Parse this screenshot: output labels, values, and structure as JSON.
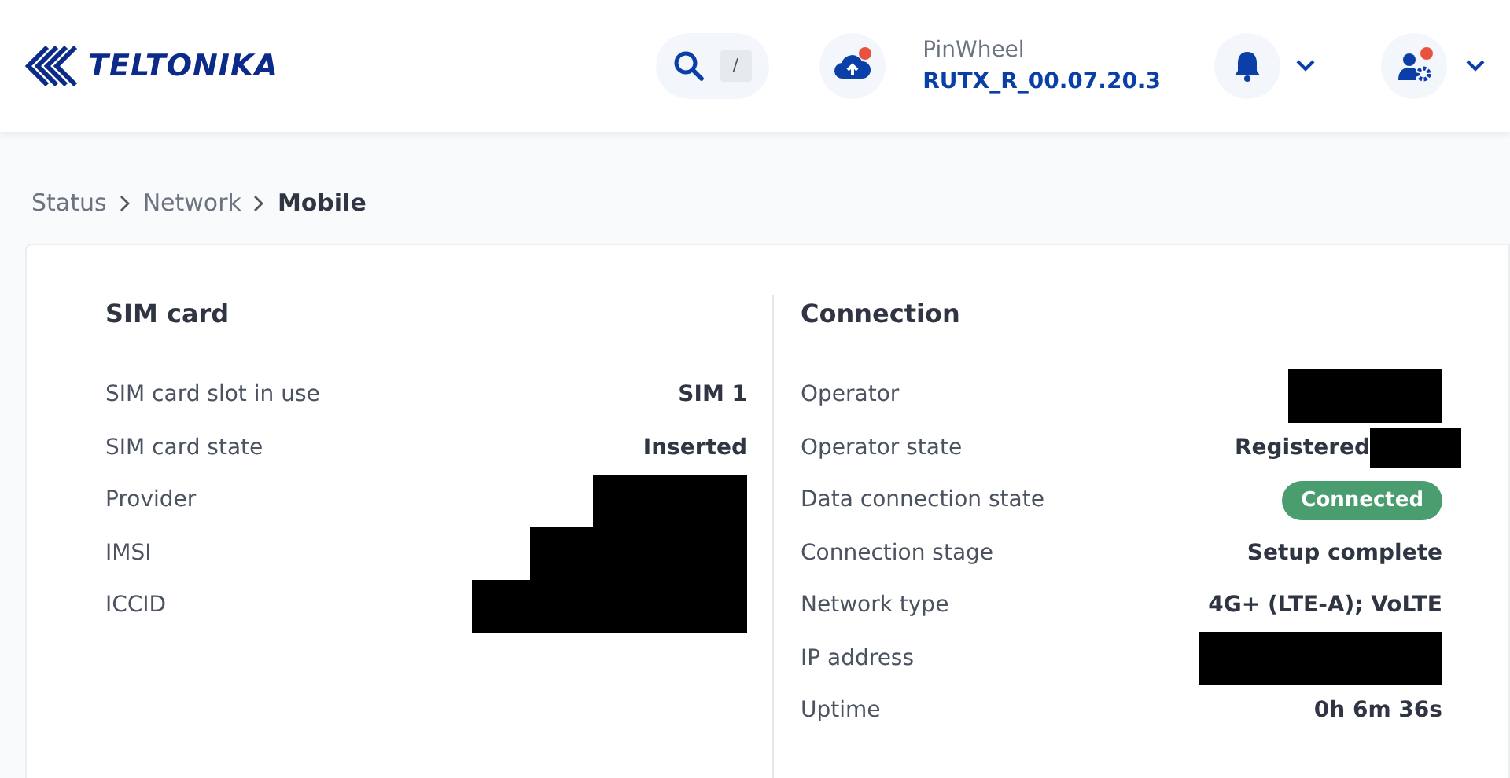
{
  "header": {
    "logo": "TELTONIKA",
    "search_shortcut": "/",
    "cloud_notification": true,
    "device_name": "PinWheel",
    "firmware": "RUTX_R_00.07.20.3",
    "user_notification": true
  },
  "breadcrumb": [
    {
      "label": "Status",
      "current": false
    },
    {
      "label": "Network",
      "current": false
    },
    {
      "label": "Mobile",
      "current": true
    }
  ],
  "sim_card": {
    "title": "SIM card",
    "rows": [
      {
        "label": "SIM card slot in use",
        "kind": "text",
        "value": "SIM 1"
      },
      {
        "label": "SIM card state",
        "kind": "text",
        "value": "Inserted"
      },
      {
        "label": "Provider",
        "kind": "redacted"
      },
      {
        "label": "IMSI",
        "kind": "redacted"
      },
      {
        "label": "ICCID",
        "kind": "redacted"
      }
    ]
  },
  "connection": {
    "title": "Connection",
    "rows": [
      {
        "label": "Operator",
        "kind": "redacted"
      },
      {
        "label": "Operator state",
        "kind": "partly_redacted",
        "value": "Registered"
      },
      {
        "label": "Data connection state",
        "kind": "badge",
        "value": "Connected",
        "color": "#4a9d6e"
      },
      {
        "label": "Connection stage",
        "kind": "text",
        "value": "Setup complete"
      },
      {
        "label": "Network type",
        "kind": "text",
        "value": "4G+ (LTE-A); VoLTE"
      },
      {
        "label": "IP address",
        "kind": "redacted"
      },
      {
        "label": "Uptime",
        "kind": "text",
        "value": "0h 6m 36s"
      }
    ]
  }
}
